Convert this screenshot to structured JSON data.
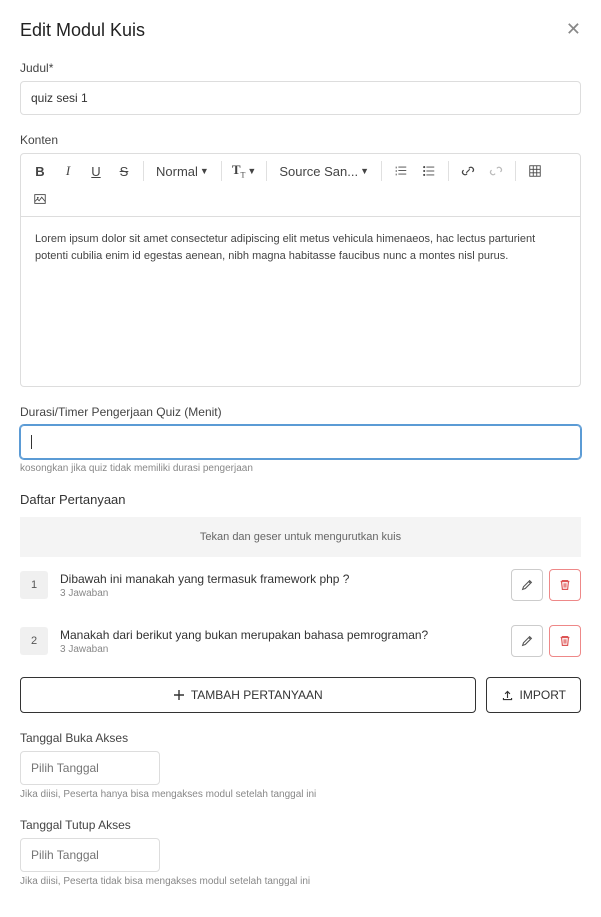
{
  "modal": {
    "title": "Edit Modul Kuis"
  },
  "fields": {
    "judul": {
      "label": "Judul*",
      "value": "quiz sesi 1"
    },
    "konten": {
      "label": "Konten"
    },
    "durasi": {
      "label": "Durasi/Timer Pengerjaan Quiz (Menit)",
      "value": "",
      "hint": "kosongkan jika quiz tidak memiliki durasi pengerjaan"
    },
    "buka": {
      "label": "Tanggal Buka Akses",
      "placeholder": "Pilih Tanggal",
      "hint": "Jika diisi, Peserta hanya bisa mengakses modul setelah tanggal ini"
    },
    "tutup": {
      "label": "Tanggal Tutup Akses",
      "placeholder": "Pilih Tanggal",
      "hint": "Jika diisi, Peserta tidak bisa mengakses modul setelah tanggal ini"
    }
  },
  "editor": {
    "paragraph_label": "Normal",
    "font_label": "Source San...",
    "content": "Lorem ipsum dolor sit amet consectetur adipiscing elit metus vehicula himenaeos, hac lectus parturient potenti cubilia enim id egestas aenean, nibh magna habitasse faucibus nunc a montes nisl purus."
  },
  "questions": {
    "section_title": "Daftar Pertanyaan",
    "drag_hint": "Tekan dan geser untuk mengurutkan kuis",
    "items": [
      {
        "num": "1",
        "text": "Dibawah ini manakah yang termasuk framework php ?",
        "meta": "3 Jawaban"
      },
      {
        "num": "2",
        "text": "Manakah dari berikut yang bukan merupakan bahasa pemrograman?",
        "meta": "3 Jawaban"
      }
    ]
  },
  "buttons": {
    "add_question": "TAMBAH PERTANYAAN",
    "import": "IMPORT"
  }
}
